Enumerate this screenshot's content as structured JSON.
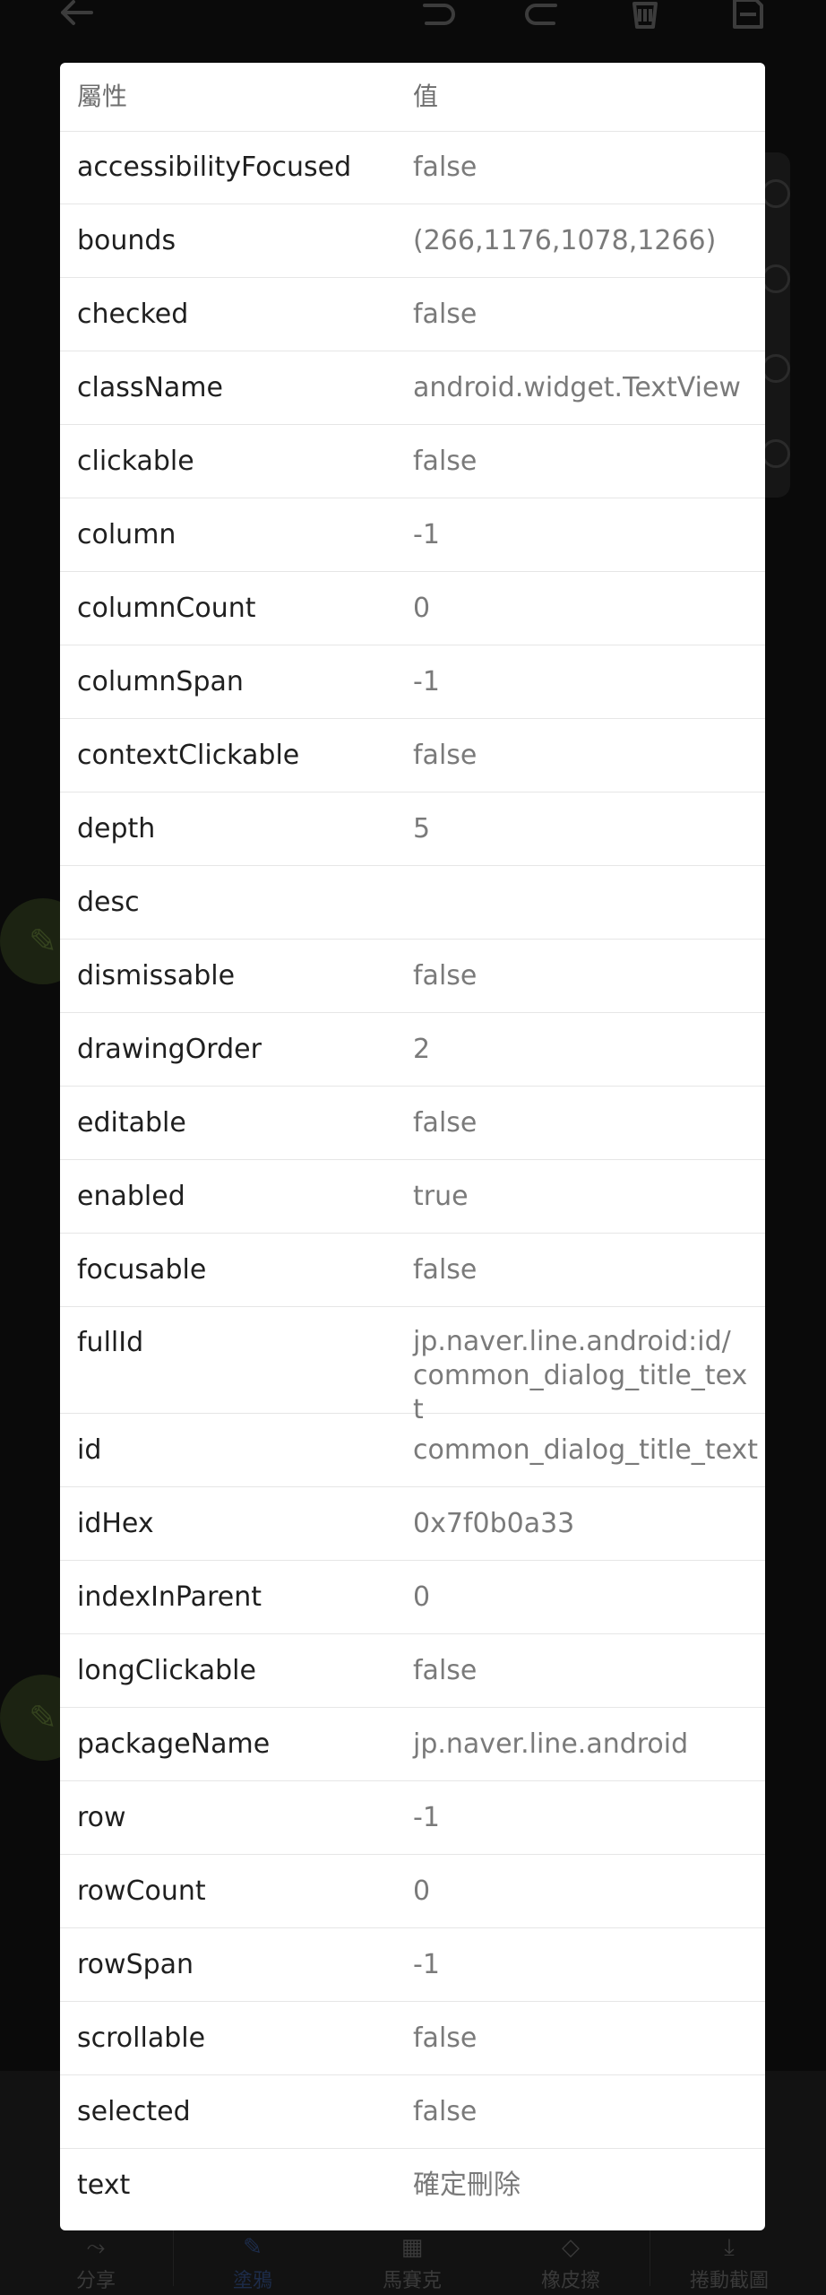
{
  "background": {
    "bottom_tabs": [
      {
        "label": "分享",
        "icon": "share-icon",
        "active": false
      },
      {
        "label": "塗鴉",
        "icon": "brush-icon",
        "active": true
      },
      {
        "label": "馬賽克",
        "icon": "mosaic-icon",
        "active": false
      },
      {
        "label": "橡皮擦",
        "icon": "eraser-icon",
        "active": false
      },
      {
        "label": "捲動截圖",
        "icon": "scroll-capture-icon",
        "active": false
      }
    ]
  },
  "dialog": {
    "header": {
      "key_label": "屬性",
      "value_label": "值"
    },
    "rows": [
      {
        "key": "accessibilityFocused",
        "value": "false"
      },
      {
        "key": "bounds",
        "value": "(266,1176,1078,1266)"
      },
      {
        "key": "checked",
        "value": "false"
      },
      {
        "key": "className",
        "value": "android.widget.TextView"
      },
      {
        "key": "clickable",
        "value": "false"
      },
      {
        "key": "column",
        "value": "-1"
      },
      {
        "key": "columnCount",
        "value": "0"
      },
      {
        "key": "columnSpan",
        "value": "-1"
      },
      {
        "key": "contextClickable",
        "value": "false"
      },
      {
        "key": "depth",
        "value": "5"
      },
      {
        "key": "desc",
        "value": ""
      },
      {
        "key": "dismissable",
        "value": "false"
      },
      {
        "key": "drawingOrder",
        "value": "2"
      },
      {
        "key": "editable",
        "value": "false"
      },
      {
        "key": "enabled",
        "value": "true"
      },
      {
        "key": "focusable",
        "value": "false"
      },
      {
        "key": "fullId",
        "value": "jp.naver.line.android:id/ common_dialog_title_text"
      },
      {
        "key": "id",
        "value": "common_dialog_title_text"
      },
      {
        "key": "idHex",
        "value": "0x7f0b0a33"
      },
      {
        "key": "indexInParent",
        "value": "0"
      },
      {
        "key": "longClickable",
        "value": "false"
      },
      {
        "key": "packageName",
        "value": "jp.naver.line.android"
      },
      {
        "key": "row",
        "value": "-1"
      },
      {
        "key": "rowCount",
        "value": "0"
      },
      {
        "key": "rowSpan",
        "value": "-1"
      },
      {
        "key": "scrollable",
        "value": "false"
      },
      {
        "key": "selected",
        "value": "false"
      },
      {
        "key": "text",
        "value": "確定刪除"
      }
    ]
  }
}
